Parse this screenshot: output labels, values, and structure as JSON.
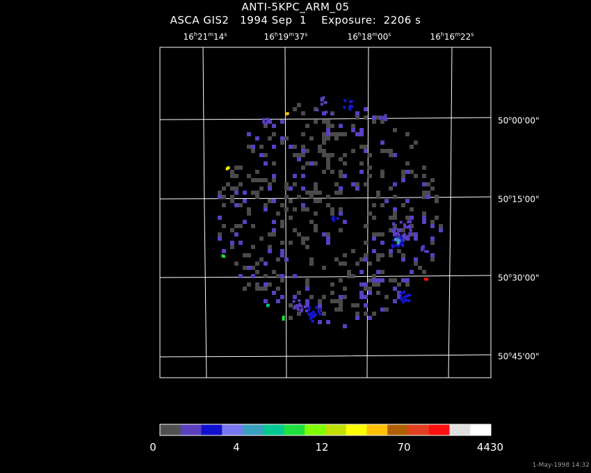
{
  "header": {
    "object": "ANTI-5KPC_ARM_05",
    "info": "ASCA GIS2   1994 Sep  1    Exposure:  2206 s"
  },
  "ra_labels": [
    {
      "h": "16",
      "m": "21",
      "s": "14"
    },
    {
      "h": "16",
      "m": "19",
      "s": "37"
    },
    {
      "h": "16",
      "m": "18",
      "s": "00"
    },
    {
      "h": "16",
      "m": "16",
      "s": "22"
    }
  ],
  "dec_labels": [
    {
      "deg": "50",
      "arcmin": "00",
      "arcsec": "00"
    },
    {
      "deg": "50",
      "arcmin": "15",
      "arcsec": "00"
    },
    {
      "deg": "50",
      "arcmin": "30",
      "arcsec": "00"
    },
    {
      "deg": "50",
      "arcmin": "45",
      "arcsec": "00"
    }
  ],
  "colorbar": {
    "colors": [
      "#4f4f4f",
      "#5a3fbf",
      "#1010d0",
      "#7878f0",
      "#3aa0c0",
      "#00c890",
      "#20e040",
      "#80ff00",
      "#c0e000",
      "#ffff00",
      "#ffc000",
      "#b06000",
      "#e04020",
      "#ff1010",
      "#e0e0e0",
      "#ffffff"
    ],
    "ticks": [
      "0",
      "4",
      "12",
      "70",
      "4430"
    ]
  },
  "timestamp": "1-May-1998 14:32"
}
